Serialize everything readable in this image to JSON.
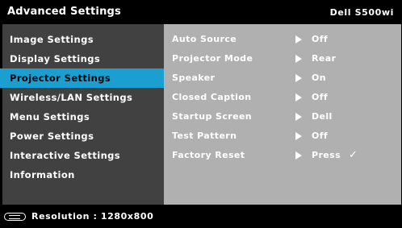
{
  "header": {
    "title": "Advanced Settings",
    "model": "Dell  S500wi"
  },
  "menu": {
    "items": [
      {
        "label": "Image Settings",
        "active": false
      },
      {
        "label": "Display Settings",
        "active": false
      },
      {
        "label": "Projector Settings",
        "active": true
      },
      {
        "label": "Wireless/LAN Settings",
        "active": false
      },
      {
        "label": "Menu Settings",
        "active": false
      },
      {
        "label": "Power Settings",
        "active": false
      },
      {
        "label": "Interactive Settings",
        "active": false
      },
      {
        "label": "Information",
        "active": false
      }
    ]
  },
  "settings": {
    "rows": [
      {
        "label": "Auto Source",
        "value": "Off"
      },
      {
        "label": "Projector Mode",
        "value": "Rear"
      },
      {
        "label": "Speaker",
        "value": "On"
      },
      {
        "label": "Closed Caption",
        "value": "Off"
      },
      {
        "label": "Startup Screen",
        "value": "Dell"
      },
      {
        "label": "Test Pattern",
        "value": "Off"
      },
      {
        "label": "Factory Reset",
        "value": "Press",
        "check": "✓"
      }
    ]
  },
  "footer": {
    "remote_icon": "remote-control-icon",
    "resolution": "Resolution : 1280x800"
  },
  "colors": {
    "accent": "#1b9fd0",
    "panel_dark": "#414141",
    "panel_light": "#b0b0b0"
  }
}
